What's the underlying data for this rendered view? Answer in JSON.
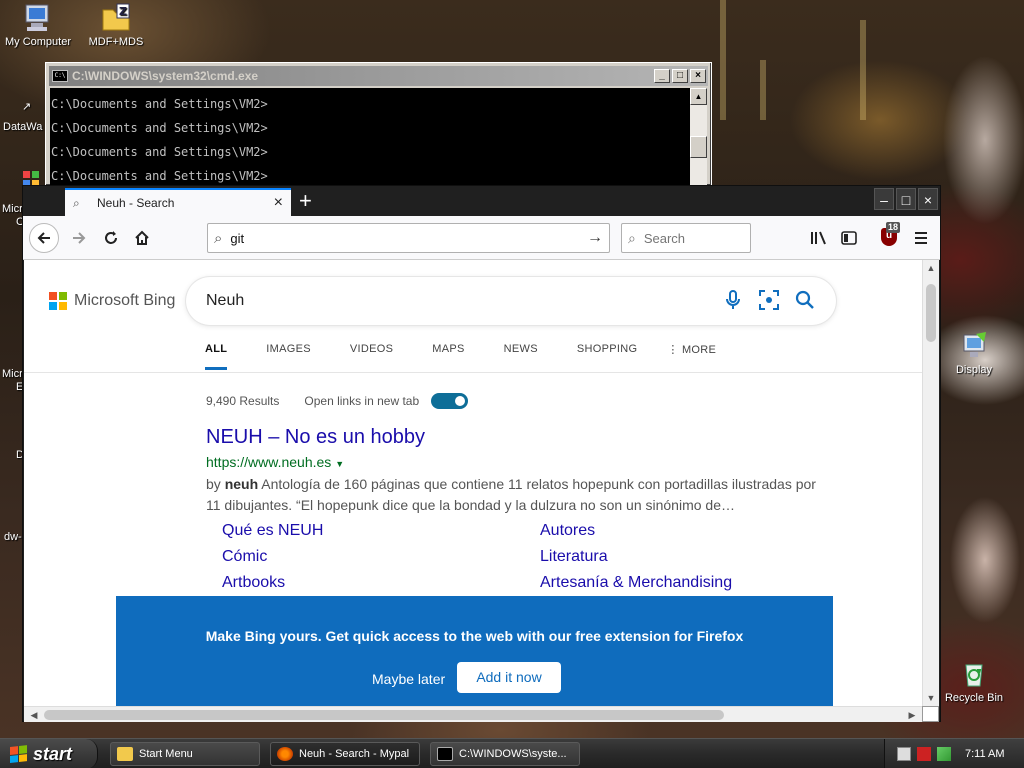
{
  "desktop": {
    "icons": [
      {
        "label": "My Computer"
      },
      {
        "label": "MDF+MDS"
      },
      {
        "label": "Display"
      },
      {
        "label": "Recycle Bin"
      }
    ],
    "clipped_labels": [
      "DataWa",
      "Micr",
      "C",
      "Micr",
      "E",
      "D",
      "dw-"
    ]
  },
  "cmd": {
    "title": "C:\\WINDOWS\\system32\\cmd.exe",
    "lines": [
      "C:\\Documents and Settings\\VM2>",
      "C:\\Documents and Settings\\VM2>",
      "C:\\Documents and Settings\\VM2>",
      "C:\\Documents and Settings\\VM2>"
    ]
  },
  "firefox": {
    "tab": {
      "label": "Neuh - Search"
    },
    "url": "git",
    "search_placeholder": "Search",
    "addon_badge": "18"
  },
  "bing": {
    "logo_text": "Microsoft Bing",
    "query": "Neuh",
    "scopes": [
      "ALL",
      "IMAGES",
      "VIDEOS",
      "MAPS",
      "NEWS",
      "SHOPPING",
      "MORE"
    ],
    "active_scope": "ALL",
    "result_count": "9,490 Results",
    "open_links_label": "Open links in new tab",
    "open_links_on": true,
    "result": {
      "title": "NEUH – No es un hobby",
      "url": "https://www.neuh.es",
      "snippet_prefix": "by ",
      "snippet_bold": "neuh",
      "snippet_rest": " Antología de 160 páginas que contiene 11 relatos hopepunk con portadillas ilustradas por 11 dibujantes. “El hopepunk dice que la bondad y la dulzura no son un sinónimo de…",
      "deeplinks": [
        "Qué es NEUH",
        "Autores",
        "Cómic",
        "Literatura",
        "Artbooks",
        "Artesanía & Merchandising"
      ]
    },
    "promo": {
      "text": "Make Bing yours. Get quick access to the web with our free extension for Firefox",
      "later_label": "Maybe later",
      "add_label": "Add it now"
    },
    "colors": {
      "accent": "#0f6cbd",
      "link": "#1a0dab",
      "url": "#006d21"
    }
  },
  "taskbar": {
    "start_label": "start",
    "items": [
      {
        "label": "Start Menu",
        "icon": "folder-icon"
      },
      {
        "label": "Neuh - Search - Mypal",
        "icon": "browser-icon"
      },
      {
        "label": "C:\\WINDOWS\\syste...",
        "icon": "cmd-icon"
      }
    ],
    "clock": "7:11 AM"
  }
}
